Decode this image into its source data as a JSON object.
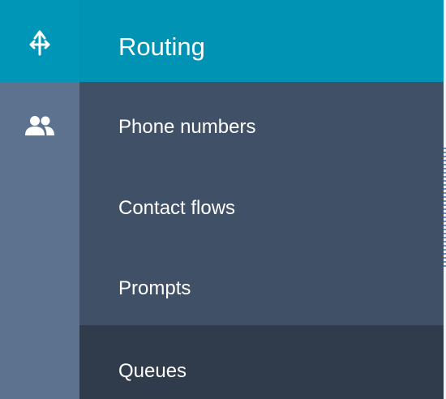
{
  "rail": {
    "items": [
      {
        "icon": "routing-icon",
        "active": true
      },
      {
        "icon": "users-icon",
        "active": false
      }
    ]
  },
  "flyout": {
    "title": "Routing",
    "items": [
      {
        "label": "Phone numbers"
      },
      {
        "label": "Contact flows"
      },
      {
        "label": "Prompts"
      },
      {
        "label": "Queues"
      }
    ]
  },
  "colors": {
    "accent": "#0093b3",
    "rail_background": "#5d728f",
    "flyout_background": "#405067",
    "hover_background": "#303b4c",
    "text": "#ffffff"
  }
}
